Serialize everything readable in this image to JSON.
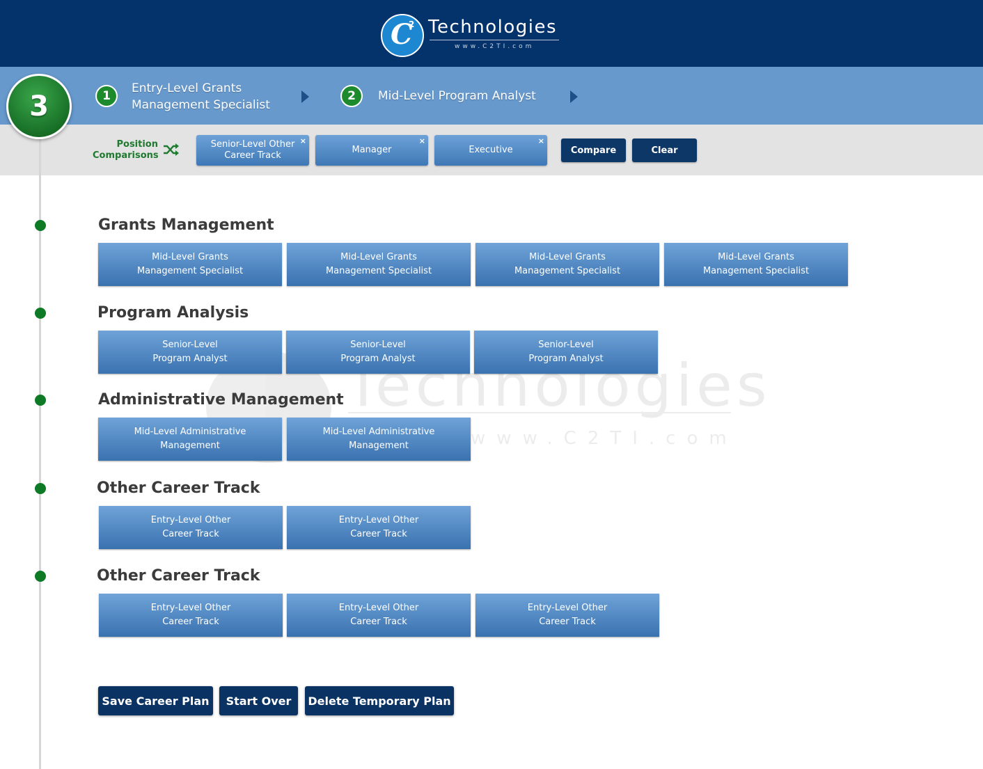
{
  "header": {
    "logo_mark": "C",
    "logo_sup": "2",
    "logo_text": "Technologies",
    "logo_url": "www.C2TI.com"
  },
  "current_step": "3",
  "steps": [
    {
      "num": "1",
      "label": "Entry-Level Grants\nManagement Specialist"
    },
    {
      "num": "2",
      "label": "Mid-Level Program Analyst"
    }
  ],
  "comparison": {
    "label": "Position\nComparisons",
    "chips": [
      {
        "label": "Senior-Level Other\nCareer Track",
        "close": "×"
      },
      {
        "label": "Manager",
        "close": "×"
      },
      {
        "label": "Executive",
        "close": "×"
      }
    ],
    "compare_label": "Compare",
    "clear_label": "Clear"
  },
  "sections": [
    {
      "title": "Grants Management",
      "tiles": [
        "Mid-Level Grants\nManagement Specialist",
        "Mid-Level Grants\nManagement Specialist",
        "Mid-Level Grants\nManagement Specialist",
        "Mid-Level Grants\nManagement Specialist"
      ]
    },
    {
      "title": "Program Analysis",
      "tiles": [
        "Senior-Level\nProgram Analyst",
        "Senior-Level\nProgram Analyst",
        "Senior-Level\nProgram Analyst"
      ]
    },
    {
      "title": "Administrative Management",
      "tiles": [
        "Mid-Level Administrative\nManagement",
        "Mid-Level Administrative\nManagement"
      ]
    },
    {
      "title": "Other Career Track",
      "tiles": [
        "Entry-Level Other\nCareer Track",
        "Entry-Level Other\nCareer Track"
      ]
    },
    {
      "title": "Other Career Track",
      "tiles": [
        "Entry-Level Other\nCareer Track",
        "Entry-Level Other\nCareer Track",
        "Entry-Level Other\nCareer Track"
      ]
    }
  ],
  "actions": {
    "save": "Save Career Plan",
    "start_over": "Start Over",
    "delete": "Delete Temporary Plan"
  },
  "colors": {
    "header_bg": "#04326a",
    "steps_bg": "#6799cd",
    "accent_green": "#1e8a2e",
    "tile_blue": "#4a82c0",
    "dark_button": "#0a3363"
  }
}
